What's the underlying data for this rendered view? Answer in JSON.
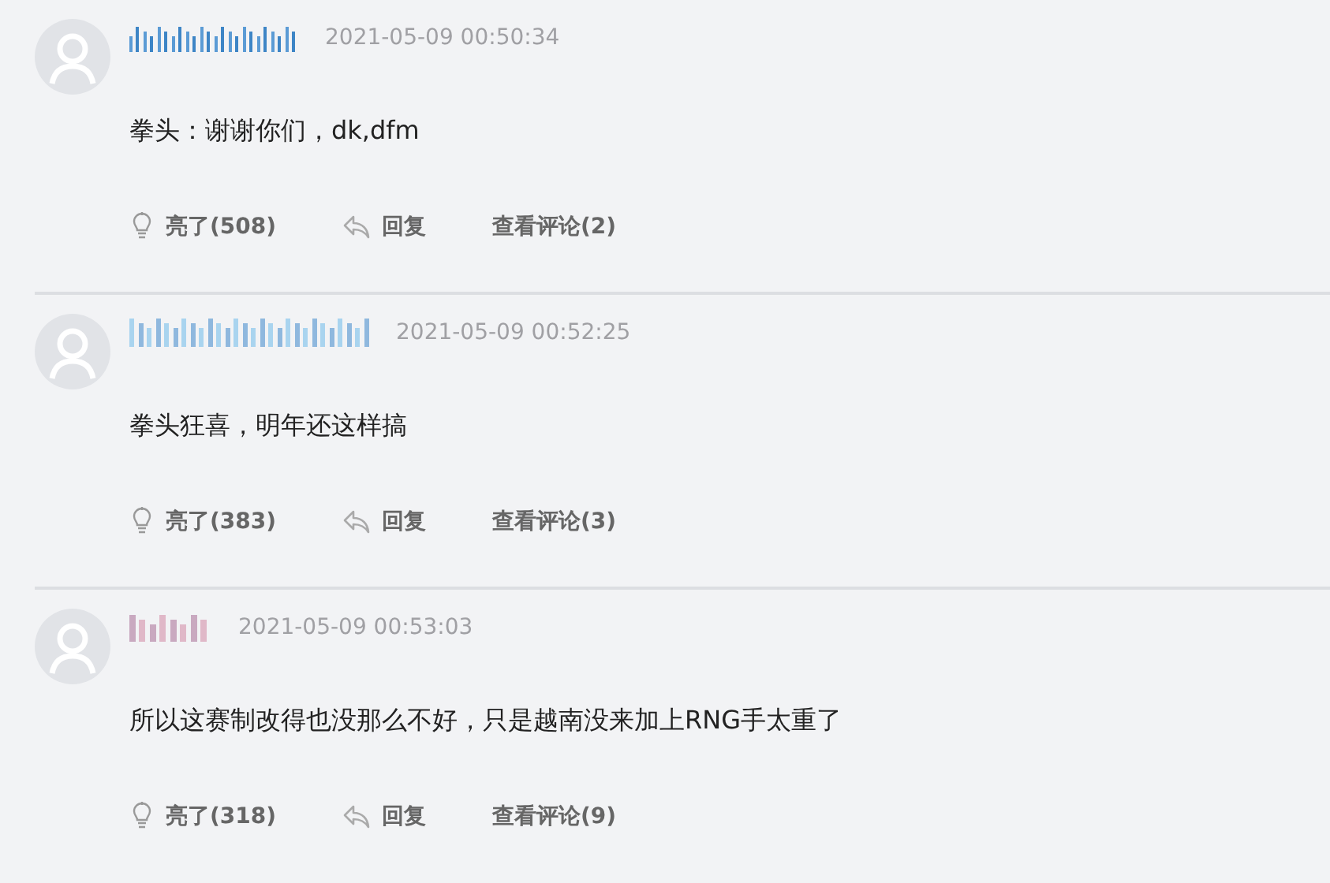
{
  "comments": [
    {
      "time": "2021-05-09 00:50:34",
      "text": "拳头：谢谢你们，dk,dfm",
      "like": "亮了(508)",
      "reply": "回复",
      "view": "查看评论(2)"
    },
    {
      "time": "2021-05-09 00:52:25",
      "text": "拳头狂喜，明年还这样搞",
      "like": "亮了(383)",
      "reply": "回复",
      "view": "查看评论(3)"
    },
    {
      "time": "2021-05-09 00:53:03",
      "text": "所以这赛制改得也没那么不好，只是越南没来加上RNG手太重了",
      "like": "亮了(318)",
      "reply": "回复",
      "view": "查看评论(9)"
    }
  ]
}
